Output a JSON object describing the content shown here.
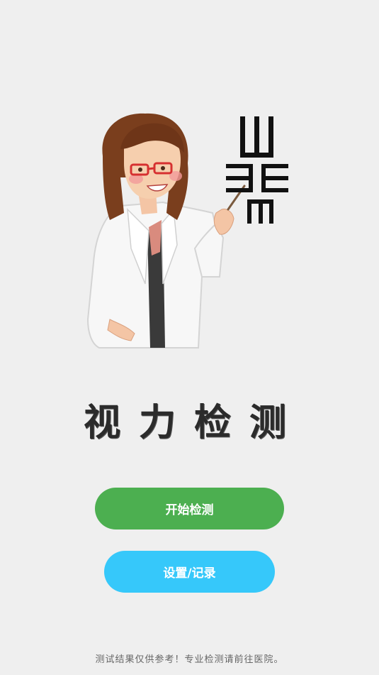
{
  "app": {
    "title": "视力检测"
  },
  "actions": {
    "start_label": "开始检测",
    "settings_label": "设置/记录"
  },
  "footer": {
    "disclaimer": "测试结果仅供参考！专业检测请前往医院。"
  },
  "colors": {
    "background": "#efefef",
    "start_button": "#4caf50",
    "settings_button": "#36c8fa",
    "title_text": "#2b2b2b",
    "chart_symbol": "#111111"
  },
  "hero": {
    "illustration": "doctor-pointing-at-eye-chart-illustration",
    "chart_icons": [
      "tumbling-e-up-icon",
      "tumbling-e-left-icon",
      "tumbling-e-right-icon",
      "tumbling-e-down-icon"
    ]
  }
}
